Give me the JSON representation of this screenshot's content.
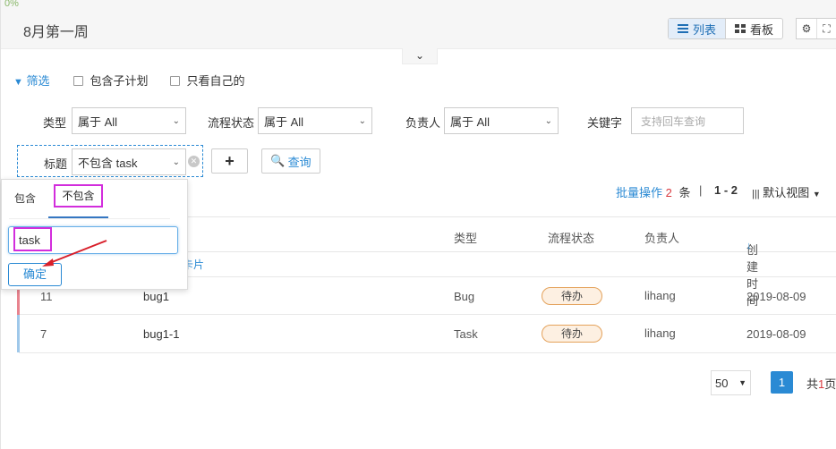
{
  "progress_text": "0%",
  "header": {
    "title": "8月第一周",
    "view_list": "列表",
    "view_board": "看板"
  },
  "filters": {
    "filter_link": "筛选",
    "include_subplan": "包含子计划",
    "only_mine": "只看自己的",
    "type_label": "类型",
    "type_value": "属于 All",
    "status_label": "流程状态",
    "status_value": "属于 All",
    "owner_label": "负责人",
    "owner_value": "属于 All",
    "keyword_label": "关键字",
    "keyword_placeholder": "支持回车查询",
    "title_label": "标题",
    "title_value": "不包含 task",
    "add_label": "+",
    "query_label": "查询"
  },
  "toolbar": {
    "batch_label": "批量操作",
    "batch_count": "2",
    "batch_unit": "条",
    "divider": "|",
    "range": "1 - 2",
    "view_select": "默认视图"
  },
  "table": {
    "columns": [
      "类型",
      "流程状态",
      "负责人",
      "创建时间"
    ],
    "card_hint": "卡片",
    "rows": [
      {
        "id": "11",
        "title": "bug1",
        "type": "Bug",
        "status": "待办",
        "owner": "lihang",
        "created": "2019-08-09",
        "color": "#e8838e"
      },
      {
        "id": "7",
        "title": "bug1-1",
        "type": "Task",
        "status": "待办",
        "owner": "lihang",
        "created": "2019-08-09",
        "color": "#9fc8ea"
      }
    ]
  },
  "pagination": {
    "page_size": "50",
    "current_page": "1",
    "total_prefix": "共",
    "total_count": "1",
    "total_suffix": "页"
  },
  "popup": {
    "tab_include": "包含",
    "tab_exclude": "不包含",
    "input_value": "task",
    "confirm_label": "确定"
  },
  "colors": {
    "accent": "#2a8ad4",
    "highlight_box": "#d22ddc",
    "annotation_arrow": "#d81f2a"
  }
}
